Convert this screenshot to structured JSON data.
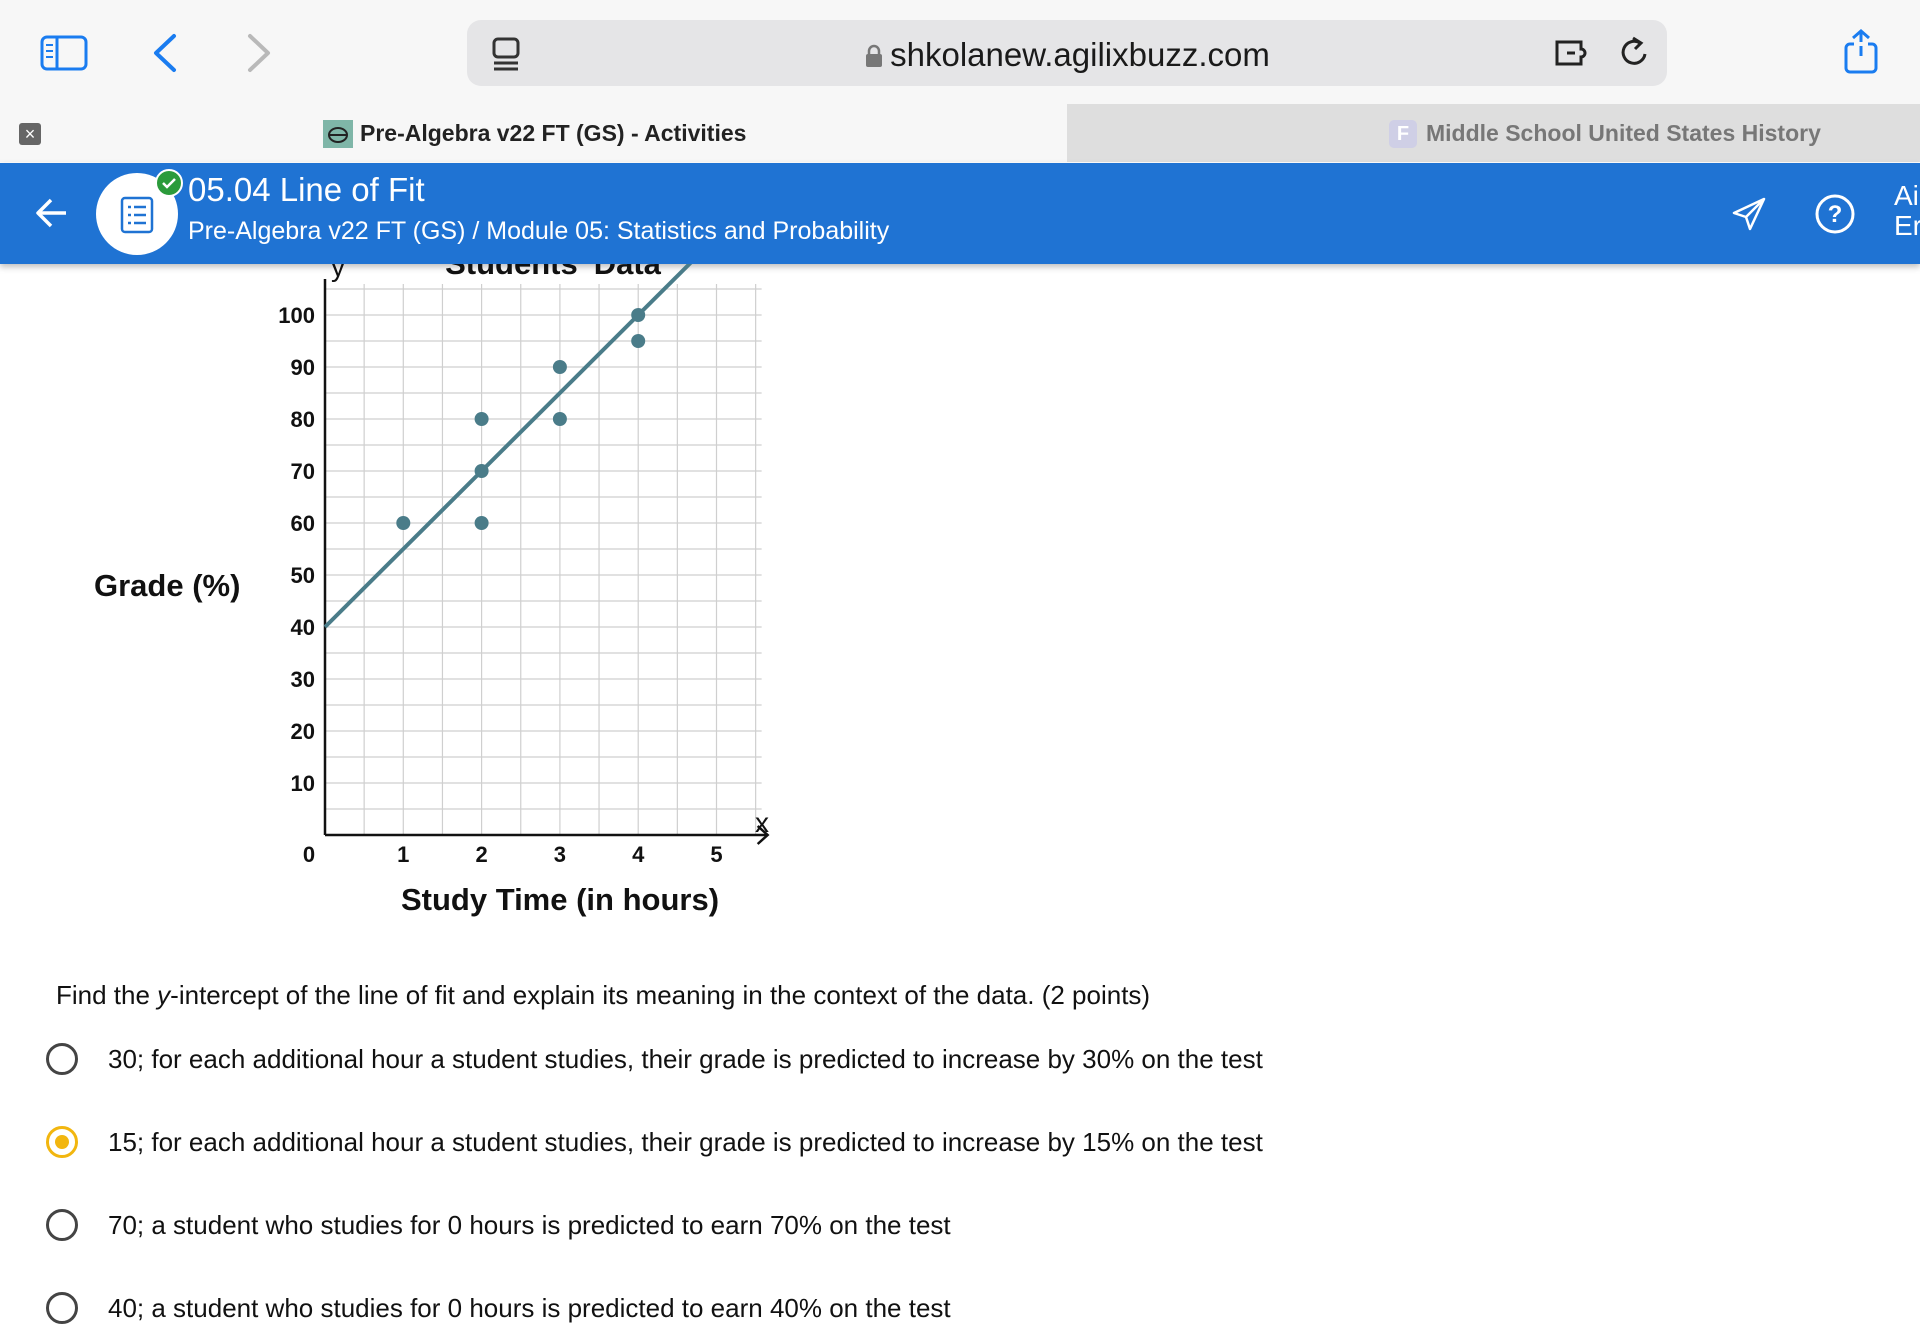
{
  "browser": {
    "url": "shkolanew.agilixbuzz.com",
    "tabs": [
      {
        "title": "Pre-Algebra v22 FT (GS) - Activities",
        "active": true
      },
      {
        "title": "Middle School United States History",
        "favicon_letter": "F",
        "active": false
      }
    ]
  },
  "app_header": {
    "title": "05.04 Line of Fit",
    "breadcrumb": "Pre-Algebra v22 FT (GS) / Module 05: Statistics and Probability",
    "right_text_line1": "Ai",
    "right_text_line2": "Er",
    "accent_color": "#1f73d3"
  },
  "chart_data": {
    "type": "scatter",
    "title": "Students' Data",
    "xlabel": "Study Time (in hours)",
    "ylabel": "Grade (%)",
    "x_axis_letter": "x",
    "y_axis_letter": "y",
    "xlim": [
      0,
      5.5
    ],
    "ylim": [
      0,
      105
    ],
    "x_ticks": [
      1,
      2,
      3,
      4,
      5
    ],
    "y_ticks": [
      10,
      20,
      30,
      40,
      50,
      60,
      70,
      80,
      90,
      100
    ],
    "origin_label": "0",
    "grid": true,
    "points": [
      {
        "x": 1,
        "y": 60
      },
      {
        "x": 2,
        "y": 80
      },
      {
        "x": 2,
        "y": 70
      },
      {
        "x": 2,
        "y": 60
      },
      {
        "x": 3,
        "y": 90
      },
      {
        "x": 3,
        "y": 80
      },
      {
        "x": 4,
        "y": 100
      },
      {
        "x": 4,
        "y": 95
      }
    ],
    "line_of_fit": {
      "slope": 15,
      "intercept": 40
    },
    "color": "#4a7c89"
  },
  "question": {
    "prefix": "Find the ",
    "italic": "y",
    "suffix": "-intercept of the line of fit and explain its meaning in the context of the data. (2 points)",
    "options": [
      {
        "text": "30; for each additional hour a student studies, their grade is predicted to increase by 30% on the test",
        "selected": false
      },
      {
        "text": "15; for each additional hour a student studies, their grade is predicted to increase by 15% on the test",
        "selected": true
      },
      {
        "text": "70; a student who studies for 0 hours is predicted to earn 70% on the test",
        "selected": false
      },
      {
        "text": "40; a student who studies for 0 hours is predicted to earn 40% on the test",
        "selected": false
      }
    ]
  }
}
